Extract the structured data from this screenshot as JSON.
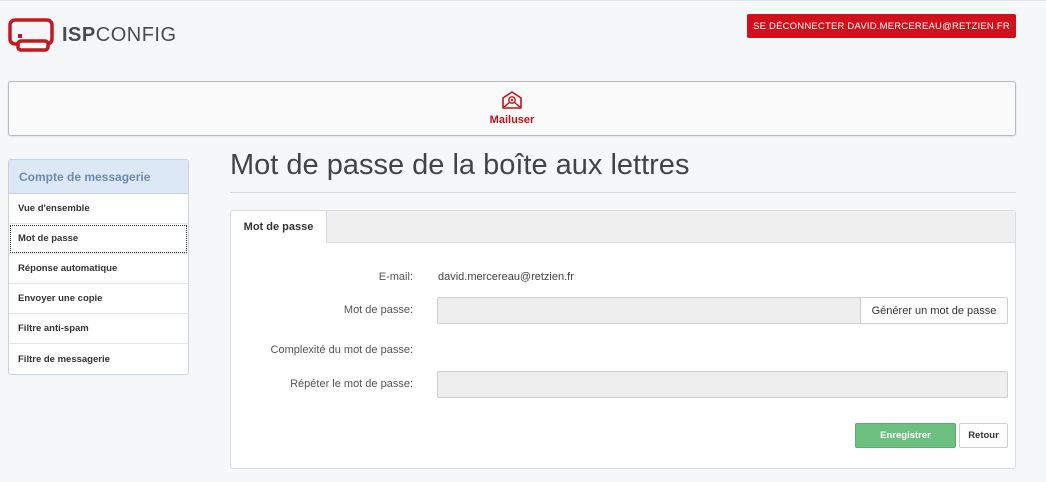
{
  "header": {
    "logo_text_bold": "ISP",
    "logo_text_light": "CONFIG",
    "logout_label": "SE DÉCONNECTER DAVID.MERCEREAU@RETZIEN.FR"
  },
  "modules": [
    {
      "label": "Mailuser",
      "icon": "envelope-at-icon",
      "active": true
    }
  ],
  "sidebar": {
    "heading": "Compte de messagerie",
    "items": [
      {
        "label": "Vue d'ensemble"
      },
      {
        "label": "Mot de passe",
        "active": true
      },
      {
        "label": "Réponse automatique"
      },
      {
        "label": "Envoyer une copie"
      },
      {
        "label": "Filtre anti-spam"
      },
      {
        "label": "Filtre de messagerie"
      }
    ]
  },
  "main": {
    "title": "Mot de passe de la boîte aux lettres",
    "tab_label": "Mot de passe",
    "form": {
      "email_label": "E-mail:",
      "email_value": "david.mercereau@retzien.fr",
      "password_label": "Mot de passe:",
      "password_value": "",
      "generate_label": "Générer un mot de passe",
      "complexity_label": "Complexité du mot de passe:",
      "repeat_label": "Répéter le mot de passe:",
      "repeat_value": ""
    },
    "save_label": "Enregistrer",
    "back_label": "Retour"
  },
  "colors": {
    "accent_red": "#d0111b",
    "save_green": "#6cc07f",
    "sidebar_head_bg": "#dce8f6"
  }
}
